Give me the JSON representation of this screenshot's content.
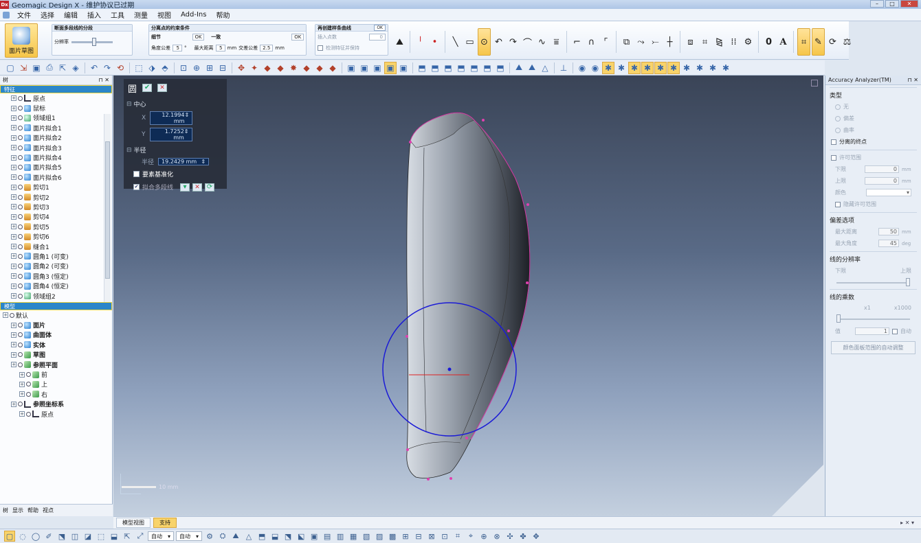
{
  "window": {
    "title": "Geomagic Design X - 维护协议已过期",
    "logo": "Dx"
  },
  "menu": [
    "文件",
    "选择",
    "编辑",
    "插入",
    "工具",
    "测量",
    "视图",
    "Add-Ins",
    "帮助"
  ],
  "ribbon": {
    "big_button": "面片草图",
    "group1": {
      "title": "断面多段线的分段",
      "label": "分辨率"
    },
    "group2": {
      "title": "分离点的约束条件",
      "sub1": "细节",
      "sub2": "一致",
      "ok1": "OK",
      "ok2": "OK",
      "angle_label": "角度公差",
      "angle_value": "5",
      "angle_unit": "°",
      "maxdist_label": "最大距离",
      "maxdist_value": "5",
      "maxdist_unit": "mm",
      "overlap_label": "交差公差",
      "overlap_value": "2.5",
      "overlap_unit": "mm"
    },
    "group3": {
      "title": "再创建样条曲线",
      "ok": "OK",
      "ctrl_label": "插入点数",
      "ctrl_value": "0",
      "opt": "检测特征并保持"
    }
  },
  "tree": {
    "header": "树",
    "section_features": "特征",
    "section_model": "模型",
    "features": [
      {
        "label": "原点",
        "icon": "coord"
      },
      {
        "label": "鼠标",
        "icon": "blue"
      },
      {
        "label": "领域组1",
        "icon": "grn"
      },
      {
        "label": "面片拟合1",
        "icon": "blue"
      },
      {
        "label": "面片拟合2",
        "icon": "blue"
      },
      {
        "label": "面片拟合3",
        "icon": "blue"
      },
      {
        "label": "面片拟合4",
        "icon": "blue"
      },
      {
        "label": "面片拟合5",
        "icon": "blue"
      },
      {
        "label": "面片拟合6",
        "icon": "blue"
      },
      {
        "label": "剪切1",
        "icon": "org"
      },
      {
        "label": "剪切2",
        "icon": "org"
      },
      {
        "label": "剪切3",
        "icon": "org"
      },
      {
        "label": "剪切4",
        "icon": "org"
      },
      {
        "label": "剪切5",
        "icon": "org"
      },
      {
        "label": "剪切6",
        "icon": "org"
      },
      {
        "label": "缝合1",
        "icon": "org"
      },
      {
        "label": "圆角1 (可变)",
        "icon": "blue"
      },
      {
        "label": "圆角2 (可变)",
        "icon": "blue"
      },
      {
        "label": "圆角3 (恒定)",
        "icon": "blue"
      },
      {
        "label": "圆角4 (恒定)",
        "icon": "blue"
      },
      {
        "label": "领域组2",
        "icon": "grn"
      }
    ],
    "model": [
      {
        "label": "默认",
        "icon": "none",
        "indent": 0
      },
      {
        "label": "面片",
        "icon": "blue",
        "indent": 1
      },
      {
        "label": "曲面体",
        "icon": "blue",
        "indent": 1
      },
      {
        "label": "实体",
        "icon": "blue",
        "indent": 1
      },
      {
        "label": "草图",
        "icon": "pln",
        "indent": 1
      },
      {
        "label": "参照平面",
        "icon": "pln",
        "indent": 1
      },
      {
        "label": "前",
        "icon": "pln",
        "indent": 2
      },
      {
        "label": "上",
        "icon": "pln",
        "indent": 2
      },
      {
        "label": "右",
        "icon": "pln",
        "indent": 2
      },
      {
        "label": "参照坐标系",
        "icon": "coord",
        "indent": 1
      },
      {
        "label": "原点",
        "icon": "coord",
        "indent": 2
      }
    ],
    "footer": [
      "树",
      "显示",
      "帮助",
      "视点"
    ]
  },
  "circle_panel": {
    "title": "圆",
    "center_label": "中心",
    "x_label": "X",
    "x_value": "12.1994 mm",
    "y_label": "Y",
    "y_value": "1.7252 mm",
    "radius_section": "半径",
    "radius_label": "半径",
    "radius_value": "19.2429 mm",
    "normalize_label": "要素基准化",
    "fit_label": "拟合多段线"
  },
  "viewport": {
    "scale_label": "10 mm"
  },
  "bottom_tabs": [
    "模型视图",
    "支持"
  ],
  "accuracy": {
    "title": "Accuracy Analyzer(TM)",
    "type_label": "类型",
    "type_options": [
      "无",
      "偏差",
      "曲率"
    ],
    "endpoint_label": "分离的终点",
    "tolerance_label": "许可范围",
    "lower_label": "下限",
    "lower_value": "0",
    "upper_label": "上限",
    "upper_value": "0",
    "unit_mm": "mm",
    "color_label": "颜色",
    "hide_label": "隐藏许可范围",
    "dev_options": "偏差选项",
    "maxdist_label": "最大距离",
    "maxdist_value": "50",
    "maxangle_label": "最大角度",
    "maxangle_value": "45",
    "unit_deg": "deg",
    "resolution_label": "线的分辨率",
    "res_low": "下限",
    "res_high": "上限",
    "multiplier_label": "线的乘数",
    "mul_low": "x1",
    "mul_high": "x1000",
    "value_label": "值",
    "value_value": "1",
    "auto_label": "自动",
    "auto_btn": "颜色面板范围的自动调整"
  },
  "status": {
    "drop1": "自动",
    "drop2": "自动"
  }
}
